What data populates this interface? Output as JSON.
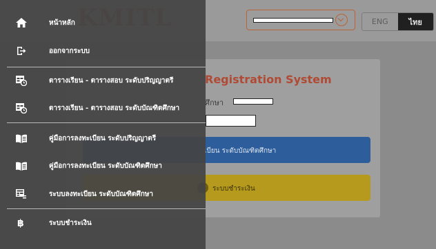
{
  "header": {
    "user_name": "",
    "lang_options": [
      "ENG",
      "ไทย"
    ],
    "active_lang": "ไทย"
  },
  "card": {
    "title": "Registration System",
    "student_label": "ศึกษา"
  },
  "buttons": {
    "graduate_registration": "เบียน ระดับบัณฑิตศึกษา",
    "payment": "ระบบชำระเงิน"
  },
  "drawer": {
    "items": [
      {
        "label": "หน้าหลัก",
        "icon": "home-icon"
      },
      {
        "label": "ออกจากระบบ",
        "icon": "logout-icon"
      },
      {
        "label": "ตารางเรียน - ตารางสอบ ระดับปริญญาตรี",
        "icon": "schedule-icon"
      },
      {
        "label": "ตารางเรียน - ตารางสอบ ระดับบัณฑิตศึกษา",
        "icon": "schedule-icon"
      },
      {
        "label": "คู่มือการลงทะเบียน ระดับปริญญาตรี",
        "icon": "book-icon"
      },
      {
        "label": "คู่มือการลงทะเบียน ระดับบัณฑิตศึกษา",
        "icon": "book-icon"
      },
      {
        "label": "ระบบลงทะเบียน ระดับบัณฑิตศึกษา",
        "icon": "registration-icon"
      },
      {
        "label": "ระบบชำระเงิน",
        "icon": "baht-icon"
      }
    ]
  },
  "colors": {
    "accent": "#b8643a",
    "primary_button": "#2d5d9a",
    "payment_button": "#b69a1d",
    "drawer_bg": "#444444"
  }
}
